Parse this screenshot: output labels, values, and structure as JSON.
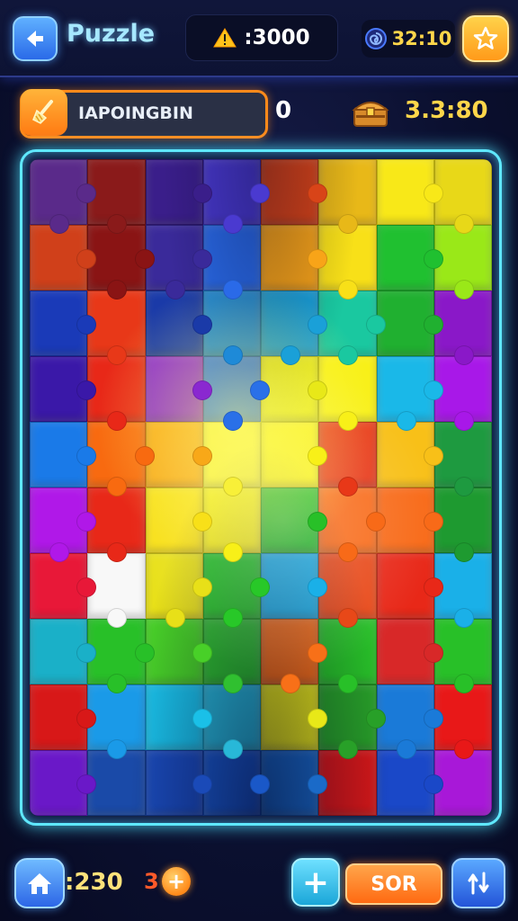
{
  "header": {
    "title": "Puzzle",
    "timer": ":3000",
    "coins": "32:10",
    "back_icon": "arrow-left-icon",
    "warning_icon": "warning-icon",
    "coin_icon": "swirl-coin-icon",
    "star_icon": "star-icon"
  },
  "level_bar": {
    "label": "IAPOINGBIN",
    "score": "0",
    "best_time": "3.3:80",
    "icon": "broom-icon",
    "chest_icon": "treasure-chest-icon"
  },
  "board": {
    "columns": 8,
    "rows": 10,
    "pieces": [
      "#5a2a8a",
      "#8a1a1a",
      "#3a1e8a",
      "#4a3ad0",
      "#d84418",
      "#e8b818",
      "#f8e818",
      "#e8d818",
      "#d0401a",
      "#8a1414",
      "#3a2a9a",
      "#2a6ae8",
      "#f8a418",
      "#f8e018",
      "#20c030",
      "#9ae818",
      "#1a3ab8",
      "#e83818",
      "#1a3aa8",
      "#1e8ad8",
      "#1aa0d8",
      "#1ac8a0",
      "#20b030",
      "#8a18c8",
      "#3a18a8",
      "#e82818",
      "#8a28d0",
      "#2a70e8",
      "#e8e818",
      "#f8f018",
      "#1ab8e8",
      "#a818e8",
      "#1a7ae8",
      "#f86a10",
      "#f8a818",
      "#f8f038",
      "#f8f018",
      "#e83818",
      "#f8c018",
      "#1e9a40",
      "#b018e8",
      "#e82818",
      "#f8e018",
      "#f8f018",
      "#28c028",
      "#f86a18",
      "#f86a18",
      "#1e9a30",
      "#e81838",
      "#f8f8f8",
      "#e8e018",
      "#28c828",
      "#1ab0e8",
      "#e84818",
      "#e82818",
      "#1ab0e8",
      "#1ab0c8",
      "#28c028",
      "#48d028",
      "#30c030",
      "#f87018",
      "#28c028",
      "#d82828",
      "#28c028",
      "#d81818",
      "#1a9ae8",
      "#1ac0e8",
      "#28b8d8",
      "#e8e818",
      "#28a028",
      "#1a7ad8",
      "#e81818",
      "#6a18c8",
      "#1a4aa8",
      "#1a4ab8",
      "#1a58c8",
      "#1a6ac8",
      "#d81818",
      "#1a48c8",
      "#a818d8"
    ]
  },
  "footer": {
    "home_icon": "home-icon",
    "moves": ":230",
    "hint_count": "3",
    "hint_plus": "+",
    "add_label": "+",
    "sort_label": "SOR",
    "shuffle_icon": "shuffle-icon"
  },
  "colors": {
    "accent_cyan": "#5fe8ff",
    "accent_orange": "#ff8a1a",
    "accent_gold": "#ffd64a",
    "background": "#0b1030"
  }
}
